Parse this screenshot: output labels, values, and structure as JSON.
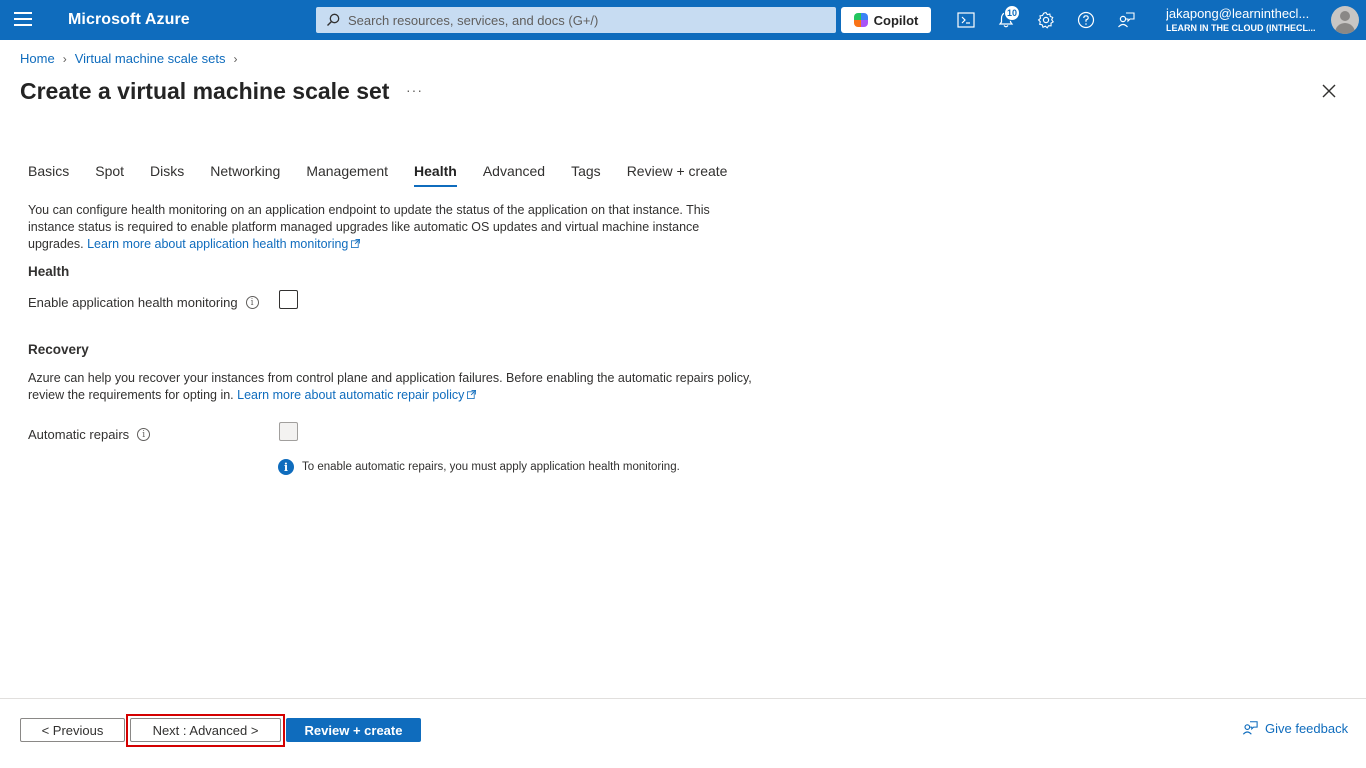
{
  "topbar": {
    "brand": "Microsoft Azure",
    "search_placeholder": "Search resources, services, and docs (G+/)",
    "copilot_label": "Copilot",
    "notification_count": "10",
    "user_name": "jakapong@learninthecl...",
    "user_org": "LEARN IN THE CLOUD (INTHECL..."
  },
  "breadcrumb": {
    "items": [
      "Home",
      "Virtual machine scale sets"
    ]
  },
  "page": {
    "title": "Create a virtual machine scale set",
    "more": "···"
  },
  "tabs": [
    "Basics",
    "Spot",
    "Disks",
    "Networking",
    "Management",
    "Health",
    "Advanced",
    "Tags",
    "Review + create"
  ],
  "active_tab": "Health",
  "health": {
    "description": "You can configure health monitoring on an application endpoint to update the status of the application on that instance. This instance status is required to enable platform managed upgrades like automatic OS updates and virtual machine instance upgrades.",
    "learn_more": "Learn more about application health monitoring",
    "section_title": "Health",
    "enable_label": "Enable application health monitoring",
    "enable_checked": false
  },
  "recovery": {
    "section_title": "Recovery",
    "description": "Azure can help you recover your instances from control plane and application failures. Before enabling the automatic repairs policy, review the requirements for opting in.",
    "learn_more": "Learn more about automatic repair policy",
    "auto_repairs_label": "Automatic repairs",
    "auto_repairs_checked": false,
    "info_note": "To enable automatic repairs, you must apply application health monitoring."
  },
  "footer": {
    "previous": "< Previous",
    "next": "Next : Advanced >",
    "review": "Review + create",
    "feedback": "Give feedback"
  },
  "colors": {
    "accent": "#0f6cbd",
    "highlight": "#d40000"
  }
}
